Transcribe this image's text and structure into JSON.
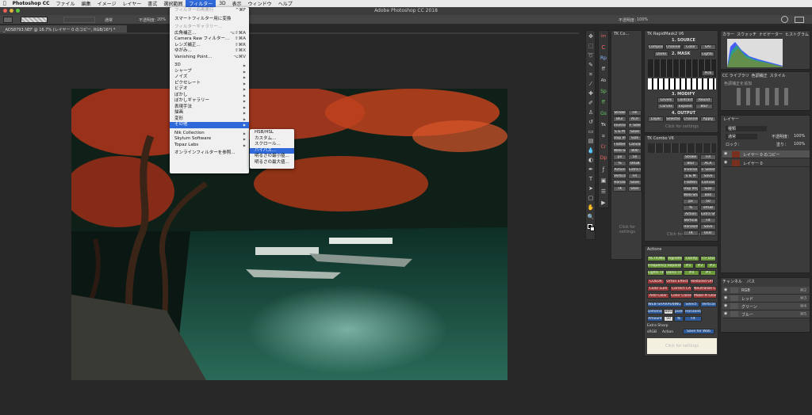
{
  "menubar": {
    "apple": "",
    "app": "Photoshop CC",
    "items": [
      "ファイル",
      "編集",
      "イメージ",
      "レイヤー",
      "書式",
      "選択範囲",
      "フィルター",
      "3D",
      "表示",
      "ウィンドウ",
      "ヘルプ"
    ]
  },
  "window": {
    "title": "Adobe Photoshop CC 2018"
  },
  "options": {
    "mode_label": "通常",
    "opacity_label": "不透明度：",
    "opacity_value": "20%",
    "flow_label": "不透明度：",
    "flow_value": "100%"
  },
  "document": {
    "tab_title": "_ADS8793.NEF @ 16.7% (レイヤー 0 のコピー, RGB/16*) *"
  },
  "filter_menu": {
    "items": [
      {
        "label": "フィルターの再実行",
        "shortcut": "^⌘F",
        "disabled": true
      },
      {
        "sep": true
      },
      {
        "label": "スマートフィルター用に変換"
      },
      {
        "sep": true
      },
      {
        "label": "フィルターギャラリー...",
        "disabled": true
      },
      {
        "label": "広角補正...",
        "shortcut": "⌥⇧⌘A"
      },
      {
        "label": "Camera Raw フィルター...",
        "shortcut": "⇧⌘A"
      },
      {
        "label": "レンズ補正...",
        "shortcut": "⇧⌘R"
      },
      {
        "label": "ゆがみ...",
        "shortcut": "⇧⌘X"
      },
      {
        "label": "Vanishing Point...",
        "shortcut": "⌥⌘V"
      },
      {
        "sep": true
      },
      {
        "label": "3D",
        "submenu": true
      },
      {
        "label": "シャープ",
        "submenu": true
      },
      {
        "label": "ノイズ",
        "submenu": true
      },
      {
        "label": "ピクセレート",
        "submenu": true
      },
      {
        "label": "ビデオ",
        "submenu": true
      },
      {
        "label": "ぼかし",
        "submenu": true
      },
      {
        "label": "ぼかしギャラリー",
        "submenu": true
      },
      {
        "label": "表現手法",
        "submenu": true
      },
      {
        "label": "描画",
        "submenu": true
      },
      {
        "label": "変形",
        "submenu": true
      },
      {
        "label": "その他",
        "submenu": true,
        "selected": true
      },
      {
        "sep": true
      },
      {
        "label": "Nik Collection",
        "submenu": true
      },
      {
        "label": "Skylum Software",
        "submenu": true
      },
      {
        "label": "Topaz Labs",
        "submenu": true
      },
      {
        "sep": true
      },
      {
        "label": "オンラインフィルターを参照..."
      }
    ]
  },
  "other_submenu": {
    "items": [
      {
        "label": "HSB/HSL"
      },
      {
        "label": "カスタム..."
      },
      {
        "label": "スクロール..."
      },
      {
        "label": "ハイパス...",
        "selected": true
      },
      {
        "label": "明るさの最小値..."
      },
      {
        "label": "明るさの最大値..."
      }
    ]
  },
  "panels": {
    "tk_combo_top": {
      "title": "TK Co..."
    },
    "tk_rapid": {
      "title": "TK RapidMask2 V6",
      "source": "1. SOURCE",
      "mask": "2. MASK",
      "modify": "3. MODIFY",
      "output": "4. OUTPUT",
      "source_btns": [
        "Composite",
        "Channel",
        "Color",
        "SAT"
      ],
      "darks": "Darks",
      "lights": "Lights",
      "pick": "Pick",
      "modify_btns": [
        "Levels",
        "Contract",
        "Round",
        "Curves",
        "Expand",
        "Blur"
      ],
      "output_btns": [
        "Layer",
        "Selection",
        "Channel",
        "Apply"
      ],
      "click": "Click for settings"
    },
    "tk_combo": {
      "title": "TK Combo V6",
      "btns": [
        "Stroke",
        "Fill",
        "Blur",
        "ACR",
        "Inverse",
        "+ Select",
        "S & M",
        "Save",
        "Flatten",
        "Canvas",
        "Dup Img",
        "Size",
        "Web-Sharpen",
        "800",
        "px",
        "50",
        "%",
        "sRGB",
        "Action",
        "Extra Sharp",
        "Vertical",
        "Fit",
        "Horizontal",
        "Save",
        "TK",
        "User"
      ],
      "click": "Click for settings"
    },
    "tk_mini": {
      "btns": [
        "Stroke",
        "Fill",
        "Blur",
        "ACR",
        "Inverse",
        "+ Select",
        "S & M",
        "Save",
        "Dup Img",
        "Size",
        "Flatten",
        "Canvas",
        "Web-Sharpen",
        "800",
        "px",
        "50",
        "%",
        "sRGB",
        "Action",
        "Extra Sharp",
        "Vertical",
        "Fit",
        "Horizontal",
        "Save",
        "TK",
        "User"
      ],
      "click": "Click for settings"
    },
    "actions": {
      "title": "Actions",
      "row1": [
        "ACTIONS",
        "Vignette",
        "Clarity",
        "<> Dust"
      ],
      "row2": [
        "Frequency Separation",
        "#1",
        "#2",
        "#3"
      ],
      "row3": [
        "Lights TP",
        "Darks TP",
        "#4",
        "#5"
      ],
      "color_title": "COLOR",
      "color_row1": [
        "Orton Effect",
        "Restored Orton"
      ],
      "color_row2": [
        "Color Lum",
        "Correct CA",
        "Neutralize Cast"
      ],
      "color_row3": [
        "Add Color",
        "Color Clone",
        "Make-It-Glow"
      ],
      "web_title": "WEB-SHARPENING",
      "web_row1": [
        "Select",
        "Vertical"
      ],
      "dimension": "Dimension",
      "dim_val": "800",
      "pixels": "pixels",
      "horizontal": "Horizontal",
      "amount": "Amount",
      "amount_val": "50",
      "pct": "%",
      "fit": "Fit",
      "extra": "Extra Sharp",
      "srgb": "sRGB",
      "action": "Action",
      "save_web": "Save for Web",
      "click": "Click for settings"
    },
    "histogram": {
      "tabs": [
        "カラー",
        "スウォッチ",
        "ナビゲーター",
        "ヒストグラム"
      ]
    },
    "libraries": {
      "tabs": [
        "CC ライブラリ",
        "色調補正",
        "スタイル"
      ],
      "add": "色調補正を追加"
    },
    "layers": {
      "tabs": [
        "レイヤー"
      ],
      "kind": "種類",
      "mode": "通常",
      "opacity_label": "不透明度：",
      "opacity": "100%",
      "lock_label": "ロック：",
      "fill_label": "塗り：",
      "fill": "100%",
      "rows": [
        {
          "name": "レイヤー 0 のコピー",
          "selected": true
        },
        {
          "name": "レイヤー 0",
          "selected": false
        }
      ]
    },
    "channels": {
      "tabs": [
        "チャンネル",
        "パス"
      ],
      "rows": [
        {
          "name": "RGB",
          "sc": "⌘2"
        },
        {
          "name": "レッド",
          "sc": "⌘3"
        },
        {
          "name": "グリーン",
          "sc": "⌘4"
        },
        {
          "name": "ブルー",
          "sc": "⌘5"
        }
      ]
    }
  },
  "colors": {
    "accent": "#2f68d8",
    "menubar": "#e9e9e9",
    "panel": "#3b3b3b",
    "canvas_bg": "#282828",
    "actions_green": "#6c9a3a",
    "actions_red": "#9a3a3a",
    "actions_blue": "#2f5a9a"
  }
}
